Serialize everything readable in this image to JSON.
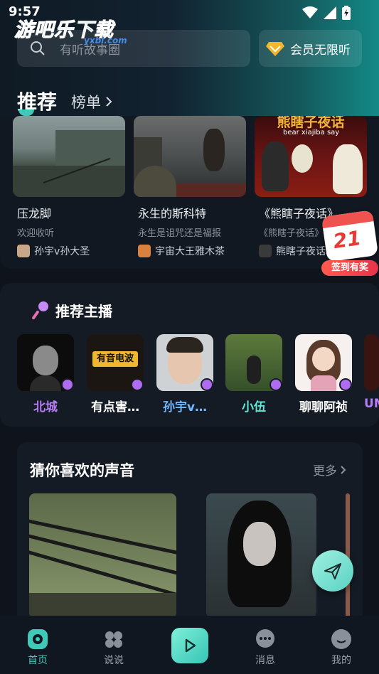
{
  "status": {
    "time": "9:57"
  },
  "watermark": {
    "title": "游吧乐下载",
    "sub": "yxbl.com"
  },
  "search": {
    "placeholder": "有听故事圈"
  },
  "vip": {
    "label": "会员无限听"
  },
  "tabs": {
    "recommend": "推荐",
    "ranking": "榜单"
  },
  "recommended": [
    {
      "title": "压龙脚",
      "desc": "欢迎收听",
      "author": "孙宇v孙大圣"
    },
    {
      "title": "永生的斯科特",
      "desc": "永生是诅咒还是福报",
      "author": "宇宙大王雅木茶"
    },
    {
      "title": "《熊瞎子夜话》",
      "desc": "《熊瞎子夜话》",
      "author": "熊瞎子夜话",
      "cover_text": "熊瞎子夜话",
      "cover_sub": "bear xiajiba say"
    }
  ],
  "signin": {
    "day": "21",
    "label": "签到有奖"
  },
  "hosts": {
    "title": "推荐主播",
    "items": [
      {
        "name": "北城",
        "color": "#b57cf5"
      },
      {
        "name": "有点害…",
        "color": "#ffffff",
        "cover_text": "有音电波"
      },
      {
        "name": "孙宇v…",
        "color": "#6fb7ff"
      },
      {
        "name": "小伍",
        "color": "#5ee6d3"
      },
      {
        "name": "聊聊阿祯",
        "color": "#ffffff"
      },
      {
        "name": "UM",
        "color": "#b57cf5"
      }
    ]
  },
  "voices": {
    "title": "猜你喜欢的声音",
    "more": "更多"
  },
  "nav": {
    "home": "首页",
    "talk": "说说",
    "messages": "消息",
    "me": "我的"
  },
  "colors": {
    "accent": "#3fc9b8",
    "background": "#0f141c"
  }
}
